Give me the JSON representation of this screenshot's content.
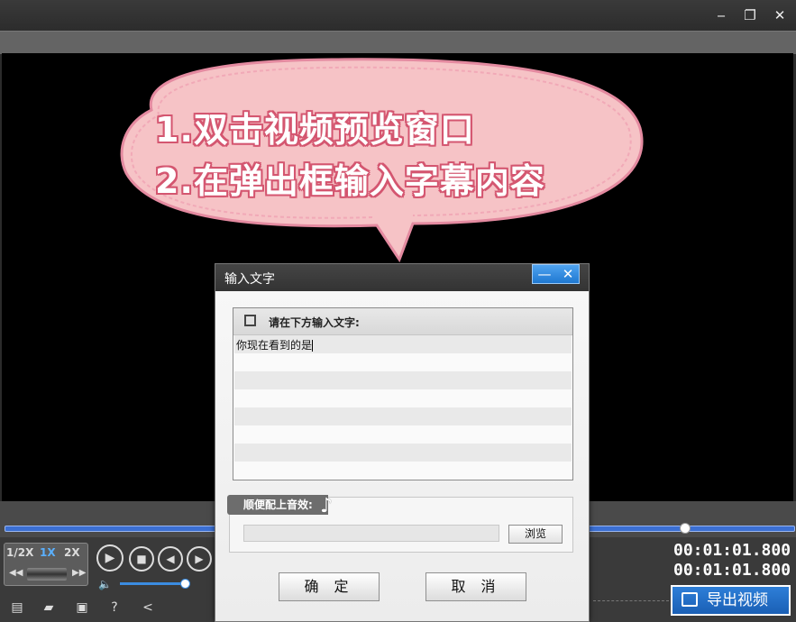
{
  "window": {
    "controls": {
      "minimize": "‒",
      "restore": "❐",
      "close": "✕"
    }
  },
  "overlay": {
    "line1": "1.双击视频预览窗口",
    "line2": "2.在弹出框输入字幕内容"
  },
  "player": {
    "speeds": [
      "1/2X",
      "1X",
      "2X"
    ],
    "active_speed": "1X",
    "current_time": "00:01:01.800",
    "total_time": "00:01:01.800",
    "progress": 0.86,
    "volume": 0.92,
    "export_label": "导出视频",
    "colors": {
      "accent": "#3b6fd3",
      "export": "#1f70c8"
    }
  },
  "dialog": {
    "title": "输入文字",
    "input_header": "请在下方输入文字:",
    "text_value": "你现在看到的是",
    "sfx_label": "顺便配上音效:",
    "sfx_path": "",
    "browse_label": "浏览",
    "confirm_label": "确 定",
    "cancel_label": "取 消"
  }
}
